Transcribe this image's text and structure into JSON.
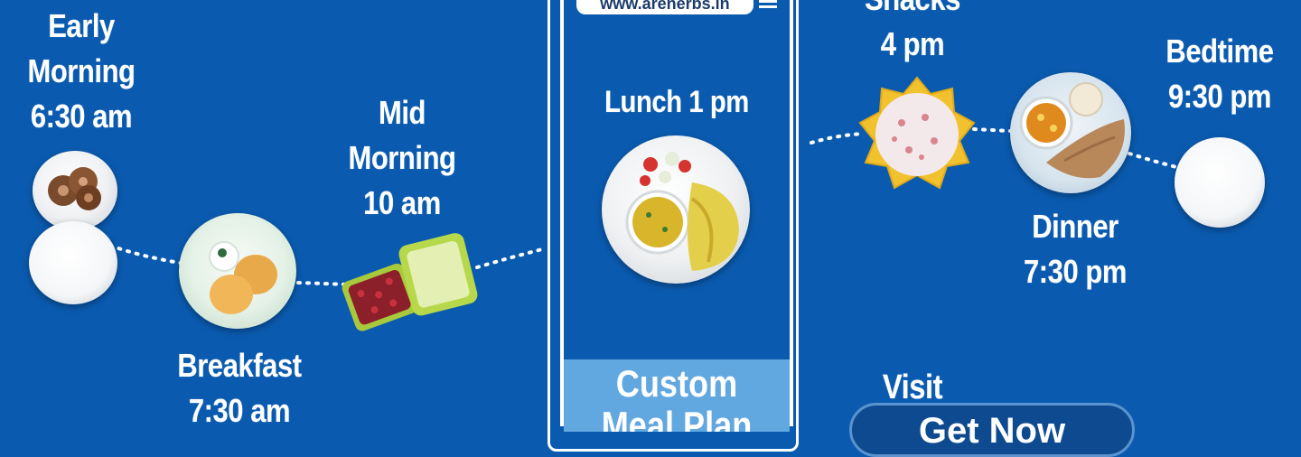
{
  "timeline": {
    "early_morning": {
      "line1": "Early",
      "line2": "Morning",
      "time": "6:30 am"
    },
    "breakfast": {
      "line1": "Breakfast",
      "time": "7:30 am"
    },
    "mid_morning": {
      "line1": "Mid",
      "line2": "Morning",
      "time": "10 am"
    },
    "lunch": {
      "label": "Lunch 1 pm"
    },
    "snacks": {
      "line1": "Snacks",
      "time": "4 pm"
    },
    "dinner": {
      "line1": "Dinner",
      "time": "7:30 pm"
    },
    "bedtime": {
      "line1": "Bedtime",
      "time": "9:30 pm"
    }
  },
  "phone": {
    "url": "www.arenerbs.in",
    "custom_line1": "Custom",
    "custom_line2": "Meal Plan"
  },
  "cta": {
    "visit_label": "Visit",
    "button_text": "Get Now"
  },
  "colors": {
    "background": "#0a5bb0",
    "accent_light": "#62a8e0",
    "text": "#ffffff"
  }
}
